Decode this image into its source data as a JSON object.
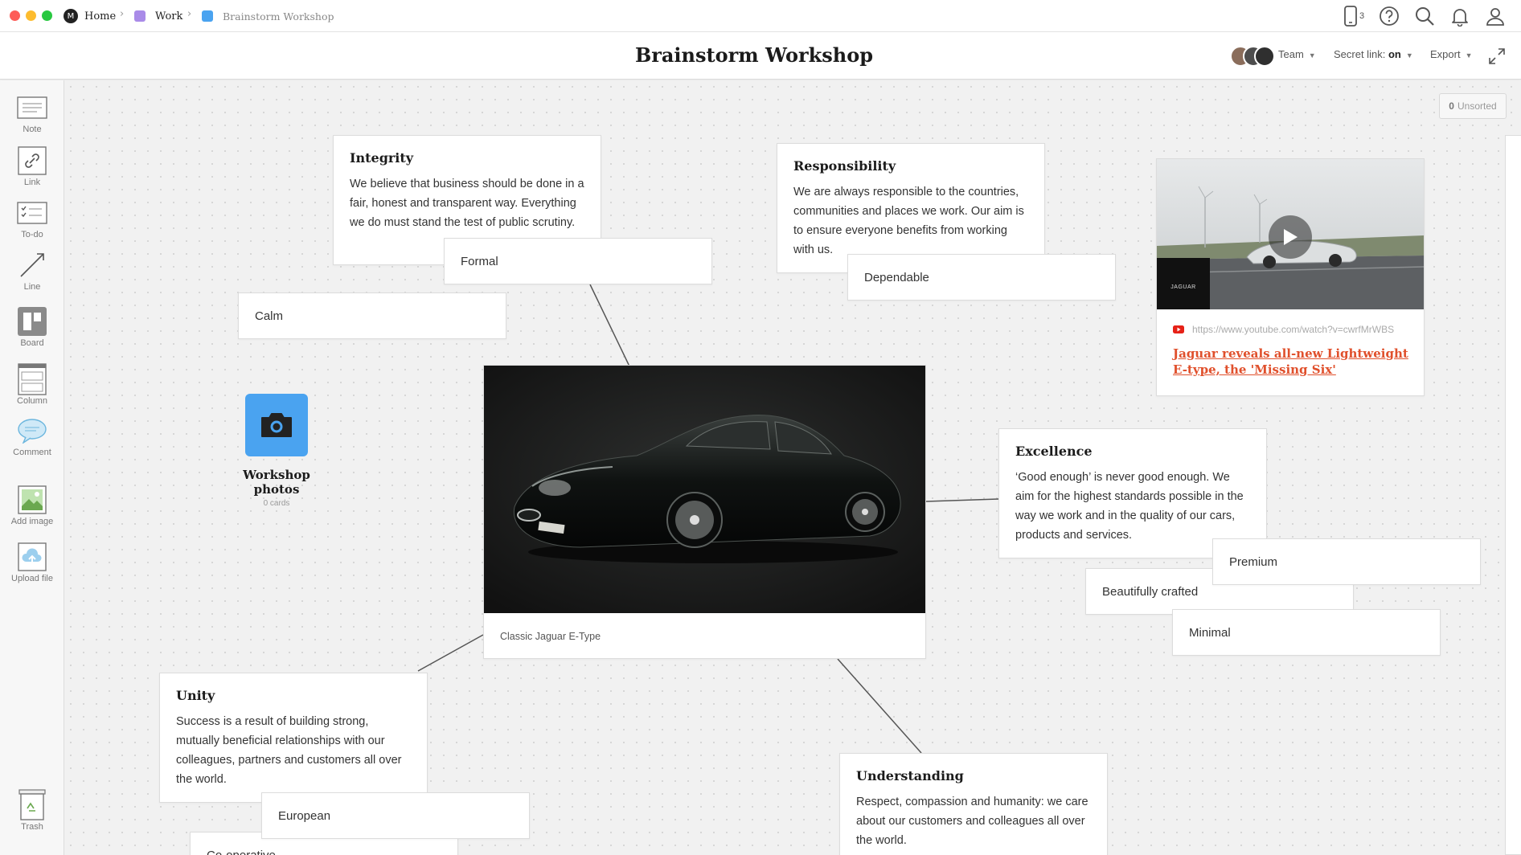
{
  "window": {
    "breadcrumb": {
      "home": "Home",
      "work": "Work",
      "current": "Brainstorm Workshop",
      "work_color": "#a98be8",
      "current_color": "#4aa3f0"
    },
    "device_count": "3",
    "icons": [
      "phone-icon",
      "help-icon",
      "search-icon",
      "bell-icon",
      "user-icon"
    ]
  },
  "header": {
    "title": "Brainstorm Workshop",
    "team_label": "Team",
    "secret_link_label": "Secret link:",
    "secret_link_value": "on",
    "export_label": "Export"
  },
  "sidebar": {
    "tools": [
      {
        "label": "Note",
        "icon": "note-icon"
      },
      {
        "label": "Link",
        "icon": "link-icon"
      },
      {
        "label": "To-do",
        "icon": "todo-icon"
      },
      {
        "label": "Line",
        "icon": "line-icon"
      },
      {
        "label": "Board",
        "icon": "board-icon"
      },
      {
        "label": "Column",
        "icon": "column-icon"
      },
      {
        "label": "Comment",
        "icon": "comment-icon"
      },
      {
        "label": "Add image",
        "icon": "image-icon"
      },
      {
        "label": "Upload file",
        "icon": "upload-icon"
      }
    ],
    "trash_label": "Trash"
  },
  "canvas": {
    "unsorted_count": "0",
    "unsorted_label": "Unsorted",
    "notes": {
      "integrity": {
        "title": "Integrity",
        "text": "We believe that business should be done in a fair, honest and transparent way. Everything we do must stand the test of public scrutiny."
      },
      "responsibility": {
        "title": "Responsibility",
        "text": "We are always responsible to the countries, communities and places we work. Our aim is to ensure everyone benefits from working with us."
      },
      "excellence": {
        "title": "Excellence",
        "text": "‘Good enough’ is never good enough. We aim for the highest standards possible in the way we work and in the quality of our cars, products and services."
      },
      "unity": {
        "title": "Unity",
        "text": "Success is a result of building strong, mutually beneficial relationships with our colleagues, partners and customers all over the world."
      },
      "understanding": {
        "title": "Understanding",
        "text": "Respect, compassion and humanity: we care about our customers and colleagues all over the world."
      }
    },
    "tags": {
      "formal": "Formal",
      "calm": "Calm",
      "dependable": "Dependable",
      "premium": "Premium",
      "beautifully_crafted": "Beautifully crafted",
      "minimal": "Minimal",
      "european": "European",
      "cooperative": "Co-operative"
    },
    "image_card": {
      "caption": "Classic Jaguar E-Type"
    },
    "video_card": {
      "url": "https://www.youtube.com/watch?v=cwrfMrWBS",
      "title": "Jaguar reveals all-new Lightweight E-type, the 'Missing Six'",
      "thumb_brand": "JAGUAR",
      "link_color": "#e0502c"
    },
    "board": {
      "title": "Workshop photos",
      "count": "0 cards",
      "color": "#4aa3f0"
    }
  }
}
